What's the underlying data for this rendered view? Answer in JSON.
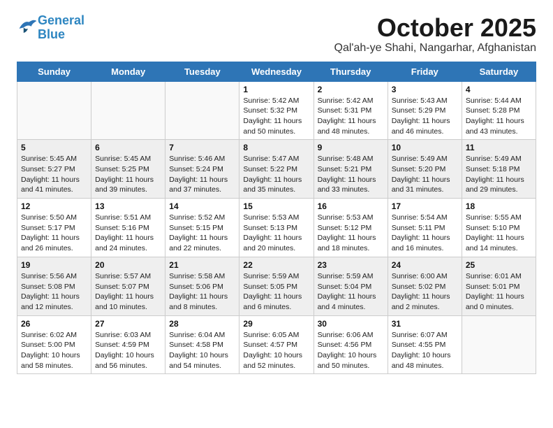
{
  "header": {
    "logo_line1": "General",
    "logo_line2": "Blue",
    "month": "October 2025",
    "location": "Qal'ah-ye Shahi, Nangarhar, Afghanistan"
  },
  "weekdays": [
    "Sunday",
    "Monday",
    "Tuesday",
    "Wednesday",
    "Thursday",
    "Friday",
    "Saturday"
  ],
  "weeks": [
    [
      {
        "day": "",
        "info": ""
      },
      {
        "day": "",
        "info": ""
      },
      {
        "day": "",
        "info": ""
      },
      {
        "day": "1",
        "info": "Sunrise: 5:42 AM\nSunset: 5:32 PM\nDaylight: 11 hours\nand 50 minutes."
      },
      {
        "day": "2",
        "info": "Sunrise: 5:42 AM\nSunset: 5:31 PM\nDaylight: 11 hours\nand 48 minutes."
      },
      {
        "day": "3",
        "info": "Sunrise: 5:43 AM\nSunset: 5:29 PM\nDaylight: 11 hours\nand 46 minutes."
      },
      {
        "day": "4",
        "info": "Sunrise: 5:44 AM\nSunset: 5:28 PM\nDaylight: 11 hours\nand 43 minutes."
      }
    ],
    [
      {
        "day": "5",
        "info": "Sunrise: 5:45 AM\nSunset: 5:27 PM\nDaylight: 11 hours\nand 41 minutes."
      },
      {
        "day": "6",
        "info": "Sunrise: 5:45 AM\nSunset: 5:25 PM\nDaylight: 11 hours\nand 39 minutes."
      },
      {
        "day": "7",
        "info": "Sunrise: 5:46 AM\nSunset: 5:24 PM\nDaylight: 11 hours\nand 37 minutes."
      },
      {
        "day": "8",
        "info": "Sunrise: 5:47 AM\nSunset: 5:22 PM\nDaylight: 11 hours\nand 35 minutes."
      },
      {
        "day": "9",
        "info": "Sunrise: 5:48 AM\nSunset: 5:21 PM\nDaylight: 11 hours\nand 33 minutes."
      },
      {
        "day": "10",
        "info": "Sunrise: 5:49 AM\nSunset: 5:20 PM\nDaylight: 11 hours\nand 31 minutes."
      },
      {
        "day": "11",
        "info": "Sunrise: 5:49 AM\nSunset: 5:18 PM\nDaylight: 11 hours\nand 29 minutes."
      }
    ],
    [
      {
        "day": "12",
        "info": "Sunrise: 5:50 AM\nSunset: 5:17 PM\nDaylight: 11 hours\nand 26 minutes."
      },
      {
        "day": "13",
        "info": "Sunrise: 5:51 AM\nSunset: 5:16 PM\nDaylight: 11 hours\nand 24 minutes."
      },
      {
        "day": "14",
        "info": "Sunrise: 5:52 AM\nSunset: 5:15 PM\nDaylight: 11 hours\nand 22 minutes."
      },
      {
        "day": "15",
        "info": "Sunrise: 5:53 AM\nSunset: 5:13 PM\nDaylight: 11 hours\nand 20 minutes."
      },
      {
        "day": "16",
        "info": "Sunrise: 5:53 AM\nSunset: 5:12 PM\nDaylight: 11 hours\nand 18 minutes."
      },
      {
        "day": "17",
        "info": "Sunrise: 5:54 AM\nSunset: 5:11 PM\nDaylight: 11 hours\nand 16 minutes."
      },
      {
        "day": "18",
        "info": "Sunrise: 5:55 AM\nSunset: 5:10 PM\nDaylight: 11 hours\nand 14 minutes."
      }
    ],
    [
      {
        "day": "19",
        "info": "Sunrise: 5:56 AM\nSunset: 5:08 PM\nDaylight: 11 hours\nand 12 minutes."
      },
      {
        "day": "20",
        "info": "Sunrise: 5:57 AM\nSunset: 5:07 PM\nDaylight: 11 hours\nand 10 minutes."
      },
      {
        "day": "21",
        "info": "Sunrise: 5:58 AM\nSunset: 5:06 PM\nDaylight: 11 hours\nand 8 minutes."
      },
      {
        "day": "22",
        "info": "Sunrise: 5:59 AM\nSunset: 5:05 PM\nDaylight: 11 hours\nand 6 minutes."
      },
      {
        "day": "23",
        "info": "Sunrise: 5:59 AM\nSunset: 5:04 PM\nDaylight: 11 hours\nand 4 minutes."
      },
      {
        "day": "24",
        "info": "Sunrise: 6:00 AM\nSunset: 5:02 PM\nDaylight: 11 hours\nand 2 minutes."
      },
      {
        "day": "25",
        "info": "Sunrise: 6:01 AM\nSunset: 5:01 PM\nDaylight: 11 hours\nand 0 minutes."
      }
    ],
    [
      {
        "day": "26",
        "info": "Sunrise: 6:02 AM\nSunset: 5:00 PM\nDaylight: 10 hours\nand 58 minutes."
      },
      {
        "day": "27",
        "info": "Sunrise: 6:03 AM\nSunset: 4:59 PM\nDaylight: 10 hours\nand 56 minutes."
      },
      {
        "day": "28",
        "info": "Sunrise: 6:04 AM\nSunset: 4:58 PM\nDaylight: 10 hours\nand 54 minutes."
      },
      {
        "day": "29",
        "info": "Sunrise: 6:05 AM\nSunset: 4:57 PM\nDaylight: 10 hours\nand 52 minutes."
      },
      {
        "day": "30",
        "info": "Sunrise: 6:06 AM\nSunset: 4:56 PM\nDaylight: 10 hours\nand 50 minutes."
      },
      {
        "day": "31",
        "info": "Sunrise: 6:07 AM\nSunset: 4:55 PM\nDaylight: 10 hours\nand 48 minutes."
      },
      {
        "day": "",
        "info": ""
      }
    ]
  ]
}
